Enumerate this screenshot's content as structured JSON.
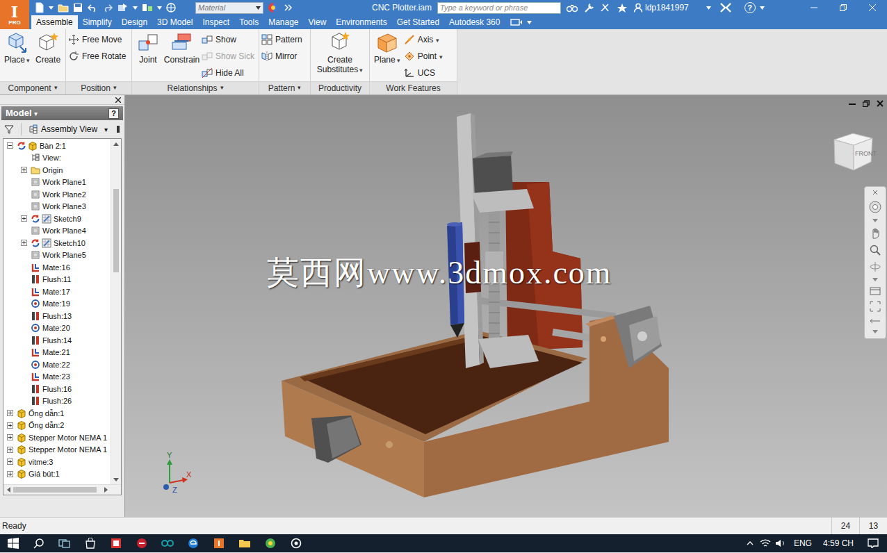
{
  "app": {
    "logo": "I",
    "edition": "PRO"
  },
  "toolbar": {
    "material": "Material"
  },
  "window": {
    "title": "CNC Plotter.iam"
  },
  "search": {
    "placeholder": "Type a keyword or phrase"
  },
  "user": {
    "name": "ldp1841997"
  },
  "help": {
    "label": "?"
  },
  "tabs": [
    {
      "label": "Assemble",
      "selected": true
    },
    {
      "label": "Simplify",
      "selected": false
    },
    {
      "label": "Design",
      "selected": false
    },
    {
      "label": "3D Model",
      "selected": false
    },
    {
      "label": "Inspect",
      "selected": false
    },
    {
      "label": "Tools",
      "selected": false
    },
    {
      "label": "Manage",
      "selected": false
    },
    {
      "label": "View",
      "selected": false
    },
    {
      "label": "Environments",
      "selected": false
    },
    {
      "label": "Get Started",
      "selected": false
    },
    {
      "label": "Autodesk 360",
      "selected": false
    }
  ],
  "ribbon": {
    "groups": [
      {
        "label": "Component",
        "arrow": "▾",
        "items": [
          {
            "label": "Place",
            "kind": "large",
            "arrow": "▾",
            "disabled": false
          },
          {
            "label": "Create",
            "kind": "large",
            "disabled": false
          }
        ]
      },
      {
        "label": "Position",
        "arrow": "▾",
        "items": [
          {
            "label": "Free Move",
            "kind": "small",
            "disabled": false
          },
          {
            "label": "Free Rotate",
            "kind": "small",
            "disabled": false
          }
        ]
      },
      {
        "label": "Relationships",
        "arrow": "▾",
        "items": [
          {
            "label": "Joint",
            "kind": "large",
            "disabled": false
          },
          {
            "label": "Constrain",
            "kind": "large",
            "disabled": false
          },
          {
            "label": "Show",
            "kind": "small",
            "disabled": false
          },
          {
            "label": "Show Sick",
            "kind": "small",
            "disabled": true
          },
          {
            "label": "Hide All",
            "kind": "small",
            "disabled": false
          }
        ]
      },
      {
        "label": "Pattern",
        "arrow": "▾",
        "items": [
          {
            "label": "Pattern",
            "kind": "small",
            "disabled": false
          },
          {
            "label": "Mirror",
            "kind": "small",
            "disabled": false
          }
        ]
      },
      {
        "label": "Productivity",
        "items": [
          {
            "label": "Create Substitutes",
            "kind": "large",
            "arrow": "▾",
            "disabled": false
          }
        ]
      },
      {
        "label": "Work Features",
        "items": [
          {
            "label": "Plane",
            "kind": "large",
            "arrow": "▾",
            "disabled": false
          },
          {
            "label": "Axis",
            "kind": "small",
            "arrow": "▾",
            "disabled": false
          },
          {
            "label": "Point",
            "kind": "small",
            "arrow": "▾",
            "disabled": false
          },
          {
            "label": "UCS",
            "kind": "small",
            "disabled": false
          }
        ]
      }
    ]
  },
  "browser": {
    "title": "Model",
    "arrow": "▾",
    "help": "?",
    "view": "Assembly View",
    "view_arrow": "▾"
  },
  "tree": [
    {
      "label": "Bàn 2:1",
      "depth": 0,
      "kind": "component",
      "expandable": true,
      "expanded": true,
      "adaptive": true
    },
    {
      "label": "View:",
      "depth": 1,
      "kind": "view",
      "expandable": false,
      "expanded": false,
      "adaptive": false
    },
    {
      "label": "Origin",
      "depth": 1,
      "kind": "folder",
      "expandable": true,
      "expanded": false,
      "adaptive": false
    },
    {
      "label": "Work Plane1",
      "depth": 1,
      "kind": "workplane",
      "expandable": false,
      "expanded": false,
      "adaptive": false
    },
    {
      "label": "Work Plane2",
      "depth": 1,
      "kind": "workplane",
      "expandable": false,
      "expanded": false,
      "adaptive": false
    },
    {
      "label": "Work Plane3",
      "depth": 1,
      "kind": "workplane",
      "expandable": false,
      "expanded": false,
      "adaptive": false
    },
    {
      "label": "Sketch9",
      "depth": 1,
      "kind": "sketch",
      "expandable": true,
      "expanded": false,
      "adaptive": true
    },
    {
      "label": "Work Plane4",
      "depth": 1,
      "kind": "workplane",
      "expandable": false,
      "expanded": false,
      "adaptive": false
    },
    {
      "label": "Sketch10",
      "depth": 1,
      "kind": "sketch",
      "expandable": true,
      "expanded": false,
      "adaptive": true
    },
    {
      "label": "Work Plane5",
      "depth": 1,
      "kind": "workplane",
      "expandable": false,
      "expanded": false,
      "adaptive": false
    },
    {
      "label": "Mate:16",
      "depth": 1,
      "kind": "mate",
      "expandable": false,
      "expanded": false,
      "adaptive": false
    },
    {
      "label": "Flush:11",
      "depth": 1,
      "kind": "flush",
      "expandable": false,
      "expanded": false,
      "adaptive": false
    },
    {
      "label": "Mate:17",
      "depth": 1,
      "kind": "mate",
      "expandable": false,
      "expanded": false,
      "adaptive": false
    },
    {
      "label": "Mate:19",
      "depth": 1,
      "kind": "insert",
      "expandable": false,
      "expanded": false,
      "adaptive": false
    },
    {
      "label": "Flush:13",
      "depth": 1,
      "kind": "flush",
      "expandable": false,
      "expanded": false,
      "adaptive": false
    },
    {
      "label": "Mate:20",
      "depth": 1,
      "kind": "insert",
      "expandable": false,
      "expanded": false,
      "adaptive": false
    },
    {
      "label": "Flush:14",
      "depth": 1,
      "kind": "flush",
      "expandable": false,
      "expanded": false,
      "adaptive": false
    },
    {
      "label": "Mate:21",
      "depth": 1,
      "kind": "mate",
      "expandable": false,
      "expanded": false,
      "adaptive": false
    },
    {
      "label": "Mate:22",
      "depth": 1,
      "kind": "insert",
      "expandable": false,
      "expanded": false,
      "adaptive": false
    },
    {
      "label": "Mate:23",
      "depth": 1,
      "kind": "mate",
      "expandable": false,
      "expanded": false,
      "adaptive": false
    },
    {
      "label": "Flush:16",
      "depth": 1,
      "kind": "flush",
      "expandable": false,
      "expanded": false,
      "adaptive": false
    },
    {
      "label": "Flush:26",
      "depth": 1,
      "kind": "flush",
      "expandable": false,
      "expanded": false,
      "adaptive": false
    },
    {
      "label": "Ống dẫn:1",
      "depth": 0,
      "kind": "component",
      "expandable": true,
      "expanded": false,
      "adaptive": false
    },
    {
      "label": "Ống dẫn:2",
      "depth": 0,
      "kind": "component",
      "expandable": true,
      "expanded": false,
      "adaptive": false
    },
    {
      "label": "Stepper Motor NEMA 1",
      "depth": 0,
      "kind": "component",
      "expandable": true,
      "expanded": false,
      "adaptive": false
    },
    {
      "label": "Stepper Motor NEMA 1",
      "depth": 0,
      "kind": "component",
      "expandable": true,
      "expanded": false,
      "adaptive": false
    },
    {
      "label": "vitme:3",
      "depth": 0,
      "kind": "component",
      "expandable": true,
      "expanded": false,
      "adaptive": false
    },
    {
      "label": "Giá bút:1",
      "depth": 0,
      "kind": "component",
      "expandable": true,
      "expanded": false,
      "adaptive": false
    }
  ],
  "viewcube": {
    "face": "FRONT"
  },
  "axes": {
    "x": "X",
    "y": "Y",
    "z": "Z"
  },
  "watermark": "莫西网www.3dmox.com",
  "status_bar": {
    "text": "Ready",
    "values": [
      "24",
      "13"
    ]
  },
  "taskbar": {
    "language": "ENG",
    "clock": "4:59 CH"
  }
}
